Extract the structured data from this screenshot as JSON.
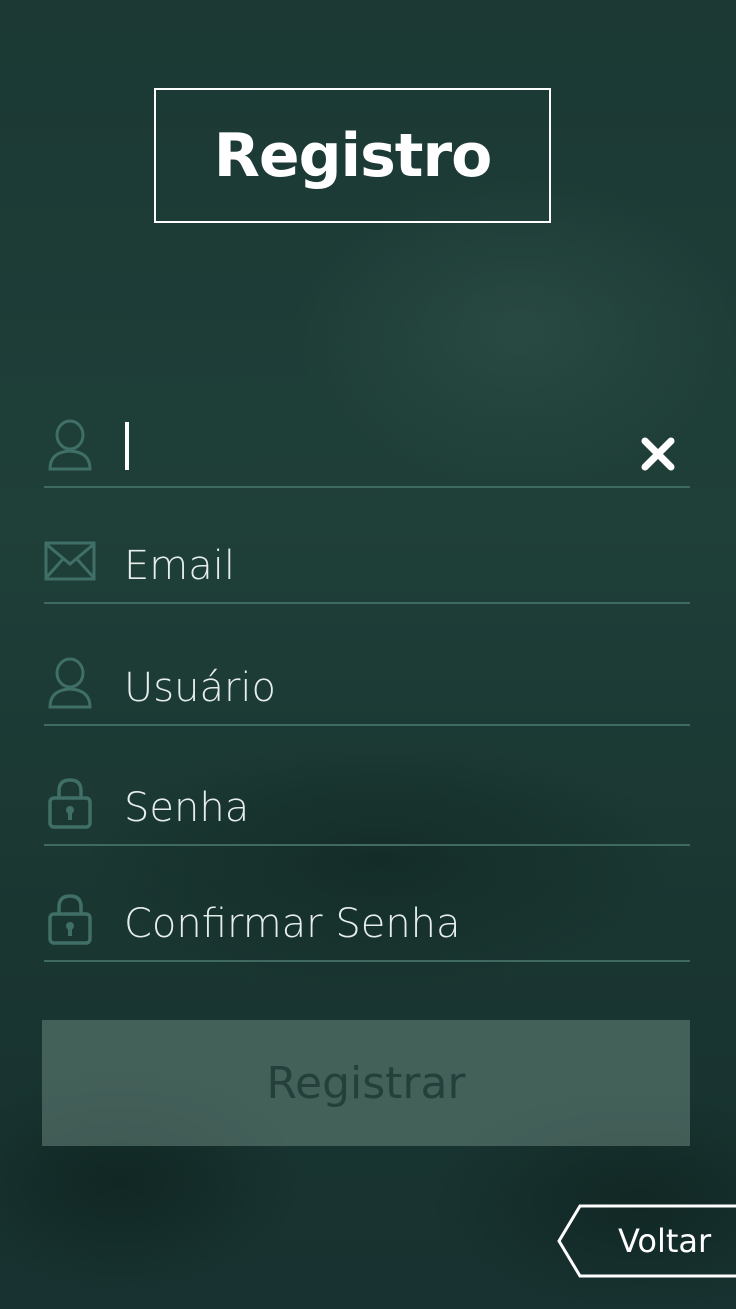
{
  "header": {
    "title": "Registro"
  },
  "form": {
    "name_field": {
      "value": "",
      "placeholder": ""
    },
    "email_field": {
      "placeholder": "Email",
      "icon": "envelope-icon"
    },
    "username_field": {
      "placeholder": "Usuário",
      "icon": "user-icon"
    },
    "password_field": {
      "placeholder": "Senha",
      "icon": "lock-icon"
    },
    "confirm_field": {
      "placeholder": "Confirmar Senha",
      "icon": "lock-icon"
    },
    "clear_icon": "close-icon",
    "submit_label": "Registrar"
  },
  "footer": {
    "back_label": "Voltar"
  },
  "colors": {
    "background": "#1c3b36",
    "underline": "#3e6a62",
    "icon_stroke": "#3f6f66",
    "button_bg": "#5c7f76"
  }
}
